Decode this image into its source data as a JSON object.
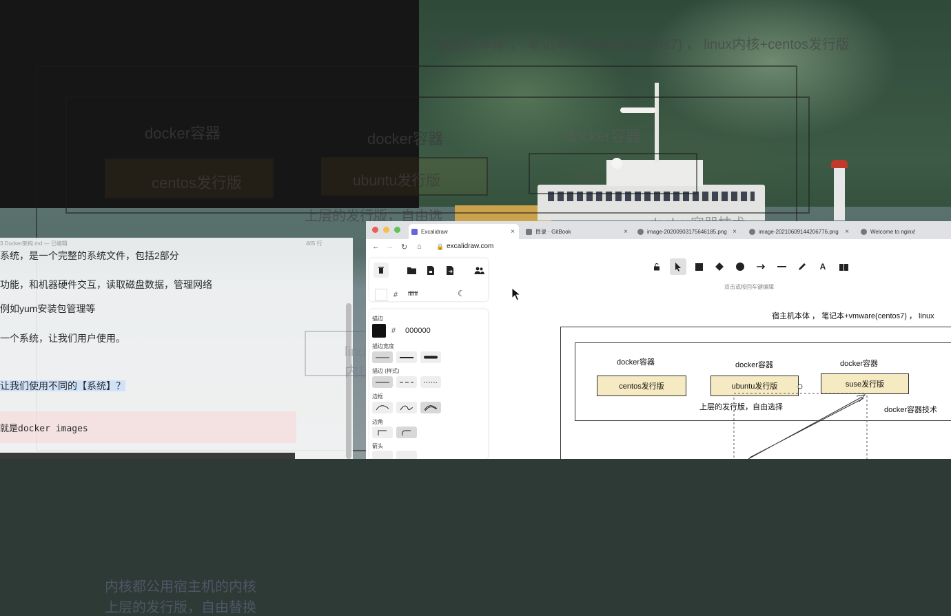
{
  "overlay": {
    "host_label": "宿主机本体 ， 笔记本+vmware(centos7) ， linux内核+centos发行版",
    "docker_container": "docker容器",
    "centos_release": "centos发行版",
    "ubuntu_release": "ubuntu发行版",
    "suse_release": "sus",
    "upper_release": "上层的发行版，自由选",
    "docker_tech": "docker容器技术",
    "kernel_line1": "内核都公用宿主机的内核",
    "kernel_line2": "上层的发行版，自由替换",
    "linux_kernel": "linux内核"
  },
  "editor": {
    "filename": "3 Docker架构.md",
    "status": "已编辑",
    "line_count": "465 行",
    "lines": [
      "系统，是一个完整的系统文件，包括2部分",
      "功能，和机器硬件交互，读取磁盘数据，管理网络",
      "例如yum安装包管理等",
      "一个系统，让我们用户使用。",
      "让我们使用不同的【系统】？",
      "就是docker  images"
    ]
  },
  "browser": {
    "tabs": [
      "Excalidraw",
      "目录 · GitBook",
      "image-20200903175646185.png",
      "image-20210609144206776.png",
      "Welcome to nginx!"
    ],
    "url": "excalidraw.com"
  },
  "excalidraw": {
    "bg_color_hex": "ffffff",
    "stroke_label": "描边",
    "stroke_color_hex": "000000",
    "stroke_width_label": "描边宽度",
    "stroke_style_label": "描边 (样式)",
    "sloppiness_label": "边框",
    "edges_label": "边角",
    "arrowheads_label": "箭头",
    "hint": "双击或按回车键编辑",
    "tool_icons": [
      "lock-icon",
      "selection-icon",
      "rectangle-icon",
      "diamond-icon",
      "ellipse-icon",
      "arrow-icon",
      "line-icon",
      "pencil-icon",
      "text-icon",
      "library-icon"
    ]
  },
  "canvas": {
    "host_label": "宿主机本体 ， 笔记本+vmware(centos7) ， linux",
    "docker_containers": [
      "docker容器",
      "docker容器",
      "docker容器"
    ],
    "distros": [
      "centos发行版",
      "ubuntu发行版",
      "suse发行版"
    ],
    "upper_release": "上层的发行版，自由选择",
    "docker_tech": "docker容器技术"
  },
  "colors": {
    "distro_fill": "#f6eac3",
    "excalidraw_accent": "#6965db",
    "selection_highlight": "#cfe2f8"
  }
}
